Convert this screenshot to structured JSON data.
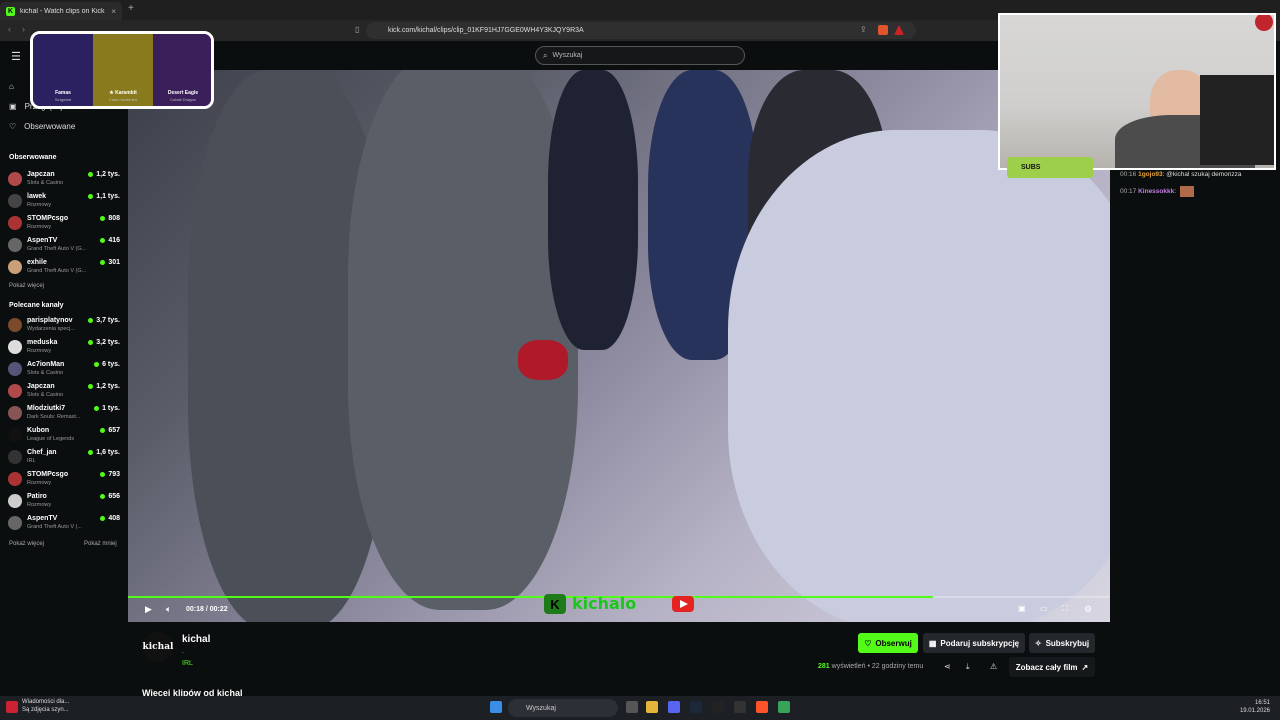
{
  "browser": {
    "tab_title": "kichal - Watch clips on Kick",
    "tab_close": "×",
    "new_tab": "+",
    "url": "kick.com/kichal/clips/clip_01KF91HJ7GGE0WH4Y3KJQY9R3A"
  },
  "kick": {
    "search_placeholder": "Wyszukaj"
  },
  "sidebar": {
    "nav": [
      "Przeglądaj",
      "Obserwowane"
    ],
    "followed_title": "Obserwowane",
    "followed": [
      {
        "name": "Japczan",
        "category": "Slots & Casino",
        "viewers": "1,2 tys.",
        "color": "#b04a4a"
      },
      {
        "name": "lawek",
        "category": "Rozmowy",
        "viewers": "1,1 tys.",
        "color": "#444"
      },
      {
        "name": "STOMPcsgo",
        "category": "Rozmowy",
        "viewers": "808",
        "color": "#a33"
      },
      {
        "name": "AspenTV",
        "category": "Grand Theft Auto V (G...",
        "viewers": "416",
        "color": "#666"
      },
      {
        "name": "exhile",
        "category": "Grand Theft Auto V (G...",
        "viewers": "301",
        "color": "#c9a07a"
      }
    ],
    "followed_more": "Pokaż więcej",
    "recommended_title": "Polecane kanały",
    "recommended": [
      {
        "name": "parisplatynov",
        "category": "Wydarzenia specj...",
        "viewers": "3,7 tys.",
        "color": "#7a4a2a"
      },
      {
        "name": "meduska",
        "category": "Rozmowy",
        "viewers": "3,2 tys.",
        "color": "#ddd"
      },
      {
        "name": "Ac7ionMan",
        "category": "Slots & Casino",
        "viewers": "6 tys.",
        "color": "#557"
      },
      {
        "name": "Japczan",
        "category": "Slots & Casino",
        "viewers": "1,2 tys.",
        "color": "#b04a4a"
      },
      {
        "name": "Mlodziutki7",
        "category": "Dark Souls: Remast...",
        "viewers": "1 tys.",
        "color": "#855"
      },
      {
        "name": "Kubon",
        "category": "League of Legends",
        "viewers": "657",
        "color": "#111"
      },
      {
        "name": "Chef_jan",
        "category": "IRL",
        "viewers": "1,6 tys.",
        "color": "#333"
      },
      {
        "name": "STOMPcsgo",
        "category": "Rozmowy",
        "viewers": "793",
        "color": "#a33"
      },
      {
        "name": "Patiro",
        "category": "Rozmowy",
        "viewers": "656",
        "color": "#ccc"
      },
      {
        "name": "AspenTV",
        "category": "Grand Theft Auto V (...",
        "viewers": "408",
        "color": "#666"
      }
    ],
    "more": "Pokaż więcej",
    "less": "Pokaż mniej"
  },
  "overlay": {
    "skins": [
      {
        "name": "Famas",
        "sub": "Sergeant"
      },
      {
        "name": "★ Karambit",
        "sub": "Case Hardened"
      },
      {
        "name": "Desert Eagle",
        "sub": "Cobalt Dragon"
      }
    ],
    "subs_label": "SUBS"
  },
  "video": {
    "time": "00:18 / 00:22",
    "progress": 0.82,
    "logo_text": "kichalo"
  },
  "chat": {
    "messages": [
      {
        "time": "00:16",
        "user": "1gojo93",
        "user_color": "#e8a23a",
        "text": ": @kichal szukaj demonzza"
      },
      {
        "time": "00:17",
        "user": "Kinessokkk",
        "user_color": "#c47de8",
        "text": ":"
      }
    ]
  },
  "channel": {
    "avatar_text": "kichal",
    "name": "kichal",
    "dot": ".",
    "category": "IRL",
    "follow": "Obserwuj",
    "gift": "Podaruj subskrypcję",
    "subscribe": "Subskrybuj",
    "views_count": "281",
    "views_label": "wyświetleń",
    "time_ago": "• 22 godziny temu",
    "watch_full": "Zobacz cały film",
    "more_clips": "Więcej klipów od kichal"
  },
  "taskbar": {
    "notif_title": "Wiadomości dla...",
    "notif_sub": "Są zdjęcia szyn...",
    "search": "Wyszukaj",
    "time": "16:51",
    "date": "19.01.2026"
  },
  "colors": {
    "accent": "#53fc18",
    "bg": "#0b0e0f"
  }
}
